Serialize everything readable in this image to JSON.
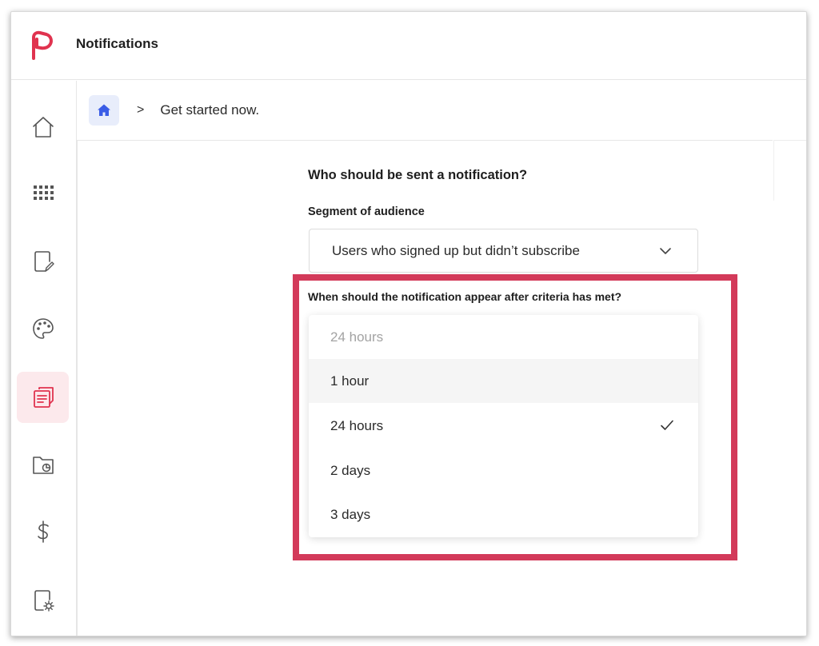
{
  "header": {
    "title": "Notifications",
    "logo_icon": "brand-logo-icon",
    "brand_color": "#e0334f"
  },
  "sidebar": {
    "items": [
      {
        "name": "home",
        "icon": "home-icon"
      },
      {
        "name": "apps",
        "icon": "grid-icon"
      },
      {
        "name": "editor",
        "icon": "document-edit-icon"
      },
      {
        "name": "theme",
        "icon": "palette-icon"
      },
      {
        "name": "notifications",
        "icon": "notification-form-icon",
        "active": true
      },
      {
        "name": "reports",
        "icon": "folder-chart-icon"
      },
      {
        "name": "billing",
        "icon": "dollar-icon"
      },
      {
        "name": "settings",
        "icon": "document-settings-icon"
      }
    ]
  },
  "breadcrumb": {
    "home_icon": "home-icon",
    "separator": ">",
    "current": "Get started now."
  },
  "form": {
    "question": "Who should be sent a notification?",
    "segment_label": "Segment of audience",
    "segment_value": "Users who signed up but didn’t subscribe",
    "when_label": "When should the notification appear after criteria has met?",
    "dropdown": {
      "placeholder": "24 hours",
      "options": [
        {
          "label": "1 hour",
          "hovered": true,
          "selected": false
        },
        {
          "label": "24 hours",
          "hovered": false,
          "selected": true
        },
        {
          "label": "2 days",
          "hovered": false,
          "selected": false
        },
        {
          "label": "3 days",
          "hovered": false,
          "selected": false
        }
      ]
    }
  },
  "highlight_color": "#d33a5a"
}
